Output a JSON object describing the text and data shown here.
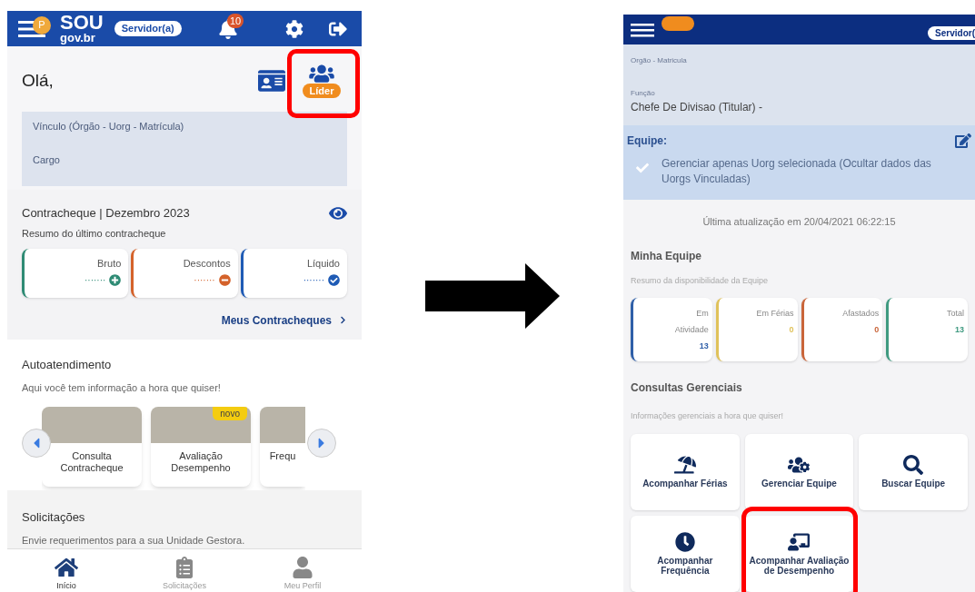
{
  "before": {
    "header": {
      "avatar_letter": "P",
      "logo_top": "SOU",
      "logo_bottom": "gov.br",
      "profile": "Servidor(a)",
      "notifications": "10"
    },
    "greeting": "Olá,",
    "leader_badge": {
      "label": "Líder",
      "highlighted": true
    },
    "info": [
      "Vínculo (Órgão - Uorg - Matrícula)",
      "Cargo"
    ],
    "payslip": {
      "title": "Contracheque | Dezembro 2023",
      "subtitle": "Resumo do último contracheque",
      "link": "Meus Contracheques",
      "cards": [
        {
          "label": "Bruto",
          "value": "·······",
          "kind": "plus",
          "color": "#2e8b74"
        },
        {
          "label": "Descontos",
          "value": "·······",
          "kind": "minus",
          "color": "#d4622a"
        },
        {
          "label": "Líquido",
          "value": "·······",
          "kind": "check",
          "color": "#1f5bb5"
        }
      ]
    },
    "self_service": {
      "title": "Autoatendimento",
      "subtitle": "Aqui você tem informação a hora que quiser!",
      "cards": [
        {
          "label": "Consulta Contracheque"
        },
        {
          "label": "Avaliação Desempenho",
          "tag": "novo"
        },
        {
          "label": "Frequ"
        }
      ]
    },
    "requests": {
      "title": "Solicitações",
      "subtitle": "Envie requerimentos para a sua Unidade Gestora."
    },
    "nav": [
      {
        "label": "Início",
        "kind": "home",
        "selected": true
      },
      {
        "label": "Solicitações",
        "kind": "clipboard",
        "selected": false
      },
      {
        "label": "Meu Perfil",
        "kind": "user",
        "selected": false
      }
    ]
  },
  "after": {
    "header": {
      "profile": "Servidor("
    },
    "org_label": "Orgão - Matricula",
    "function_label": "Função",
    "function_value": "Chefe De Divisao (Titular) -",
    "team": {
      "title": "Equipe:",
      "option": "Gerenciar apenas Uorg selecionada (Ocultar dados das Uorgs Vinculadas)",
      "checked": true
    },
    "updated": "Última atualização em 20/04/2021 06:22:15",
    "my_team": {
      "title": "Minha Equipe",
      "subtitle": "Resumo da disponibilidade da Equipe",
      "stats": [
        {
          "label": "Em Atividade",
          "value": "13",
          "color": "#2f5fa8"
        },
        {
          "label": "Em Férias",
          "value": "0",
          "color": "#e0c25a"
        },
        {
          "label": "Afastados",
          "value": "0",
          "color": "#c9653a"
        },
        {
          "label": "Total",
          "value": "13",
          "color": "#3f9a80"
        }
      ]
    },
    "queries": {
      "title": "Consultas Gerenciais",
      "subtitle": "Informações gerenciais a hora que quiser!",
      "tiles": [
        {
          "label": "Acompanhar Férias",
          "kind": "umbrella",
          "highlighted": false
        },
        {
          "label": "Gerenciar Equipe",
          "kind": "team",
          "highlighted": false
        },
        {
          "label": "Buscar Equipe",
          "kind": "search",
          "highlighted": false
        },
        {
          "label": "Acompanhar Frequência",
          "kind": "clock",
          "highlighted": false
        },
        {
          "label": "Acompanhar Avaliação de Desempenho",
          "kind": "evaluation",
          "highlighted": true
        }
      ]
    }
  }
}
